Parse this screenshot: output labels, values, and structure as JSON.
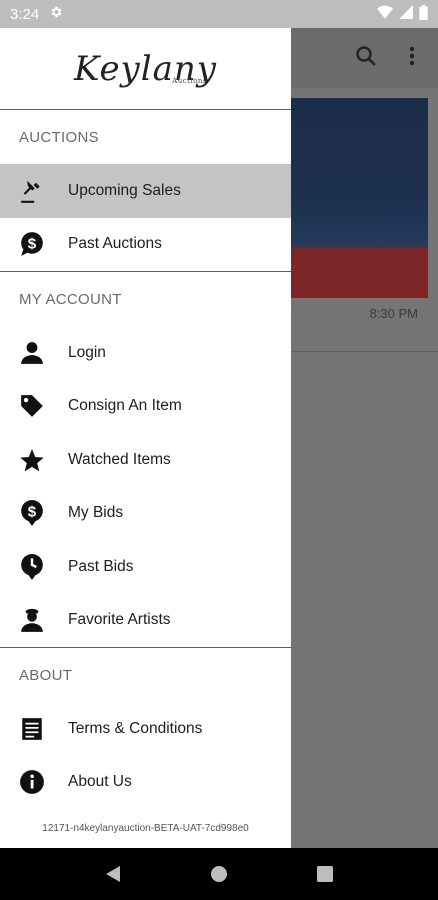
{
  "status_bar": {
    "time": "3:24"
  },
  "drawer": {
    "logo": {
      "name": "Keylany",
      "sub": "Auctions"
    },
    "sections": {
      "auctions": {
        "title": "AUCTIONS",
        "items": [
          {
            "label": "Upcoming Sales",
            "icon": "gavel-icon"
          },
          {
            "label": "Past Auctions",
            "icon": "dollar-bubble-icon"
          }
        ]
      },
      "account": {
        "title": "MY ACCOUNT",
        "items": [
          {
            "label": "Login",
            "icon": "person-icon"
          },
          {
            "label": "Consign An Item",
            "icon": "tag-icon"
          },
          {
            "label": "Watched Items",
            "icon": "star-icon"
          },
          {
            "label": "My Bids",
            "icon": "dollar-pin-icon"
          },
          {
            "label": "Past Bids",
            "icon": "clock-pin-icon"
          },
          {
            "label": "Favorite Artists",
            "icon": "artist-icon"
          }
        ]
      },
      "about": {
        "title": "ABOUT",
        "items": [
          {
            "label": "Terms & Conditions",
            "icon": "document-icon"
          },
          {
            "label": "About Us",
            "icon": "info-icon"
          }
        ]
      }
    },
    "build_id": "12171-n4keylanyauction-BETA-UAT-7cd998e0"
  },
  "background": {
    "time_label": "8:30 PM"
  },
  "colors": {
    "active_item": "#c4c4c4",
    "scrim": "#757575",
    "status_bar": "#bdbdbd"
  }
}
